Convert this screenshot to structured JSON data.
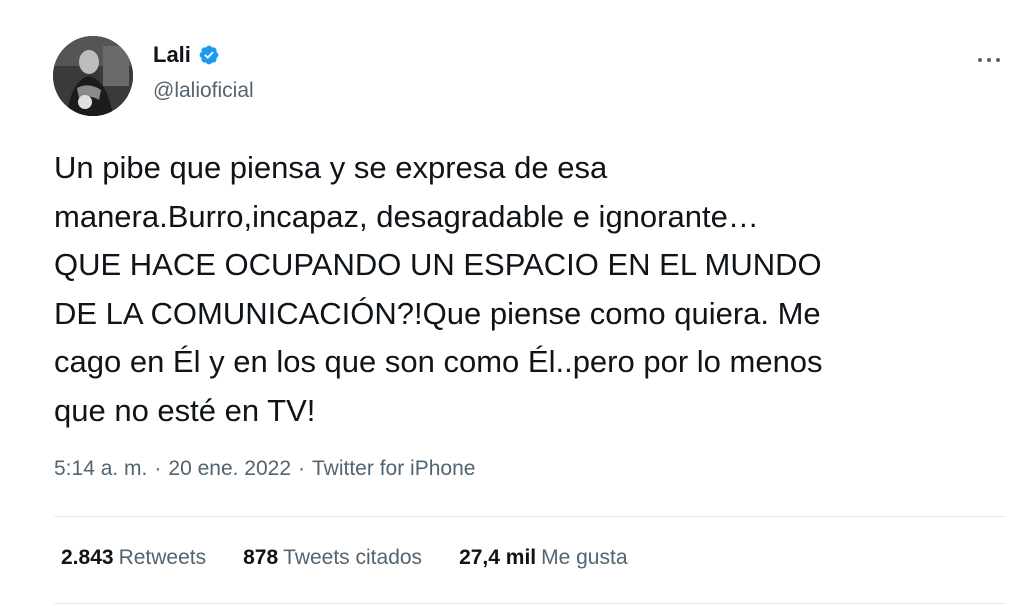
{
  "author": {
    "display_name": "Lali",
    "handle": "@lalioficial",
    "verified": true,
    "avatar_icon": "profile-photo",
    "verified_icon": "verified-badge-icon",
    "verified_color": "#1d9bf0"
  },
  "more_icon": "more-options-icon",
  "tweet": {
    "text": "Un pibe que piensa y se expresa de esa\nmanera.Burro,incapaz, desagradable e ignorante…\nQUE HACE OCUPANDO UN ESPACIO EN EL MUNDO\nDE LA COMUNICACIÓN?!Que piense como quiera. Me\ncago en Él y en los que son como Él..pero por lo menos\nque no esté en TV!",
    "time": "5:14 a. m.",
    "separator": "·",
    "date": "20 ene. 2022",
    "source": "Twitter for iPhone"
  },
  "stats": [
    {
      "count": "2.843",
      "label": "Retweets"
    },
    {
      "count": "878",
      "label": "Tweets citados"
    },
    {
      "count": "27,4 mil",
      "label": "Me gusta"
    }
  ]
}
